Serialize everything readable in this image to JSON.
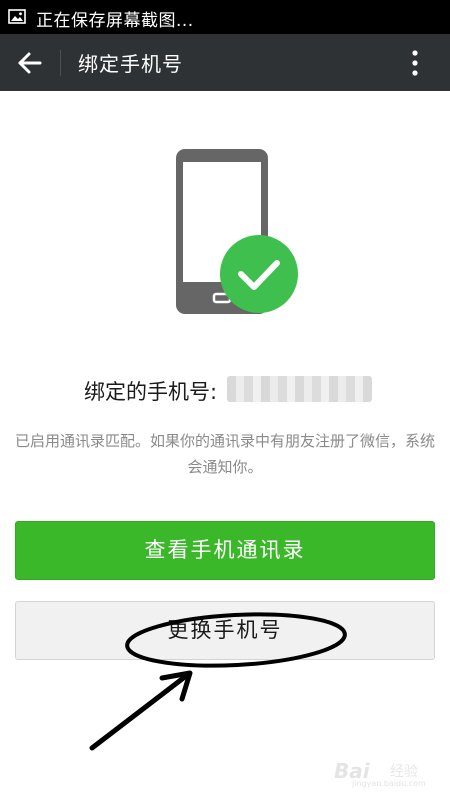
{
  "status_bar": {
    "notification_icon": "image-icon",
    "text": "正在保存屏幕截图..."
  },
  "toolbar": {
    "back_icon": "arrow-left-icon",
    "title": "绑定手机号",
    "more_icon": "more-vertical-icon"
  },
  "illustration": {
    "icon": "phone-check-icon",
    "check_color": "#3fbf4e"
  },
  "binding": {
    "label": "绑定的手机号:",
    "number_redacted": true
  },
  "notice": "已启用通讯录匹配。如果你的通讯录中有朋友注册了微信，系统会通知你。",
  "buttons": {
    "view_contacts": "查看手机通讯录",
    "change_number": "更换手机号"
  },
  "watermark": {
    "logo": "Bai",
    "text": "经验",
    "url": "jingyan.baidu.com"
  },
  "colors": {
    "toolbar": "#2f3235",
    "primary_button": "#3bb82a",
    "secondary_button": "#f1f1f1"
  }
}
